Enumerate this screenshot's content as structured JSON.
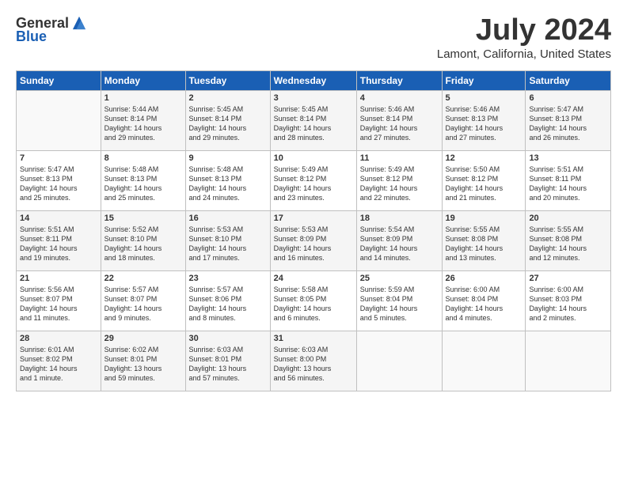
{
  "header": {
    "logo_general": "General",
    "logo_blue": "Blue",
    "month": "July 2024",
    "location": "Lamont, California, United States"
  },
  "weekdays": [
    "Sunday",
    "Monday",
    "Tuesday",
    "Wednesday",
    "Thursday",
    "Friday",
    "Saturday"
  ],
  "weeks": [
    [
      {
        "day": "",
        "info": ""
      },
      {
        "day": "1",
        "info": "Sunrise: 5:44 AM\nSunset: 8:14 PM\nDaylight: 14 hours\nand 29 minutes."
      },
      {
        "day": "2",
        "info": "Sunrise: 5:45 AM\nSunset: 8:14 PM\nDaylight: 14 hours\nand 29 minutes."
      },
      {
        "day": "3",
        "info": "Sunrise: 5:45 AM\nSunset: 8:14 PM\nDaylight: 14 hours\nand 28 minutes."
      },
      {
        "day": "4",
        "info": "Sunrise: 5:46 AM\nSunset: 8:14 PM\nDaylight: 14 hours\nand 27 minutes."
      },
      {
        "day": "5",
        "info": "Sunrise: 5:46 AM\nSunset: 8:13 PM\nDaylight: 14 hours\nand 27 minutes."
      },
      {
        "day": "6",
        "info": "Sunrise: 5:47 AM\nSunset: 8:13 PM\nDaylight: 14 hours\nand 26 minutes."
      }
    ],
    [
      {
        "day": "7",
        "info": "Sunrise: 5:47 AM\nSunset: 8:13 PM\nDaylight: 14 hours\nand 25 minutes."
      },
      {
        "day": "8",
        "info": "Sunrise: 5:48 AM\nSunset: 8:13 PM\nDaylight: 14 hours\nand 25 minutes."
      },
      {
        "day": "9",
        "info": "Sunrise: 5:48 AM\nSunset: 8:13 PM\nDaylight: 14 hours\nand 24 minutes."
      },
      {
        "day": "10",
        "info": "Sunrise: 5:49 AM\nSunset: 8:12 PM\nDaylight: 14 hours\nand 23 minutes."
      },
      {
        "day": "11",
        "info": "Sunrise: 5:49 AM\nSunset: 8:12 PM\nDaylight: 14 hours\nand 22 minutes."
      },
      {
        "day": "12",
        "info": "Sunrise: 5:50 AM\nSunset: 8:12 PM\nDaylight: 14 hours\nand 21 minutes."
      },
      {
        "day": "13",
        "info": "Sunrise: 5:51 AM\nSunset: 8:11 PM\nDaylight: 14 hours\nand 20 minutes."
      }
    ],
    [
      {
        "day": "14",
        "info": "Sunrise: 5:51 AM\nSunset: 8:11 PM\nDaylight: 14 hours\nand 19 minutes."
      },
      {
        "day": "15",
        "info": "Sunrise: 5:52 AM\nSunset: 8:10 PM\nDaylight: 14 hours\nand 18 minutes."
      },
      {
        "day": "16",
        "info": "Sunrise: 5:53 AM\nSunset: 8:10 PM\nDaylight: 14 hours\nand 17 minutes."
      },
      {
        "day": "17",
        "info": "Sunrise: 5:53 AM\nSunset: 8:09 PM\nDaylight: 14 hours\nand 16 minutes."
      },
      {
        "day": "18",
        "info": "Sunrise: 5:54 AM\nSunset: 8:09 PM\nDaylight: 14 hours\nand 14 minutes."
      },
      {
        "day": "19",
        "info": "Sunrise: 5:55 AM\nSunset: 8:08 PM\nDaylight: 14 hours\nand 13 minutes."
      },
      {
        "day": "20",
        "info": "Sunrise: 5:55 AM\nSunset: 8:08 PM\nDaylight: 14 hours\nand 12 minutes."
      }
    ],
    [
      {
        "day": "21",
        "info": "Sunrise: 5:56 AM\nSunset: 8:07 PM\nDaylight: 14 hours\nand 11 minutes."
      },
      {
        "day": "22",
        "info": "Sunrise: 5:57 AM\nSunset: 8:07 PM\nDaylight: 14 hours\nand 9 minutes."
      },
      {
        "day": "23",
        "info": "Sunrise: 5:57 AM\nSunset: 8:06 PM\nDaylight: 14 hours\nand 8 minutes."
      },
      {
        "day": "24",
        "info": "Sunrise: 5:58 AM\nSunset: 8:05 PM\nDaylight: 14 hours\nand 6 minutes."
      },
      {
        "day": "25",
        "info": "Sunrise: 5:59 AM\nSunset: 8:04 PM\nDaylight: 14 hours\nand 5 minutes."
      },
      {
        "day": "26",
        "info": "Sunrise: 6:00 AM\nSunset: 8:04 PM\nDaylight: 14 hours\nand 4 minutes."
      },
      {
        "day": "27",
        "info": "Sunrise: 6:00 AM\nSunset: 8:03 PM\nDaylight: 14 hours\nand 2 minutes."
      }
    ],
    [
      {
        "day": "28",
        "info": "Sunrise: 6:01 AM\nSunset: 8:02 PM\nDaylight: 14 hours\nand 1 minute."
      },
      {
        "day": "29",
        "info": "Sunrise: 6:02 AM\nSunset: 8:01 PM\nDaylight: 13 hours\nand 59 minutes."
      },
      {
        "day": "30",
        "info": "Sunrise: 6:03 AM\nSunset: 8:01 PM\nDaylight: 13 hours\nand 57 minutes."
      },
      {
        "day": "31",
        "info": "Sunrise: 6:03 AM\nSunset: 8:00 PM\nDaylight: 13 hours\nand 56 minutes."
      },
      {
        "day": "",
        "info": ""
      },
      {
        "day": "",
        "info": ""
      },
      {
        "day": "",
        "info": ""
      }
    ]
  ]
}
